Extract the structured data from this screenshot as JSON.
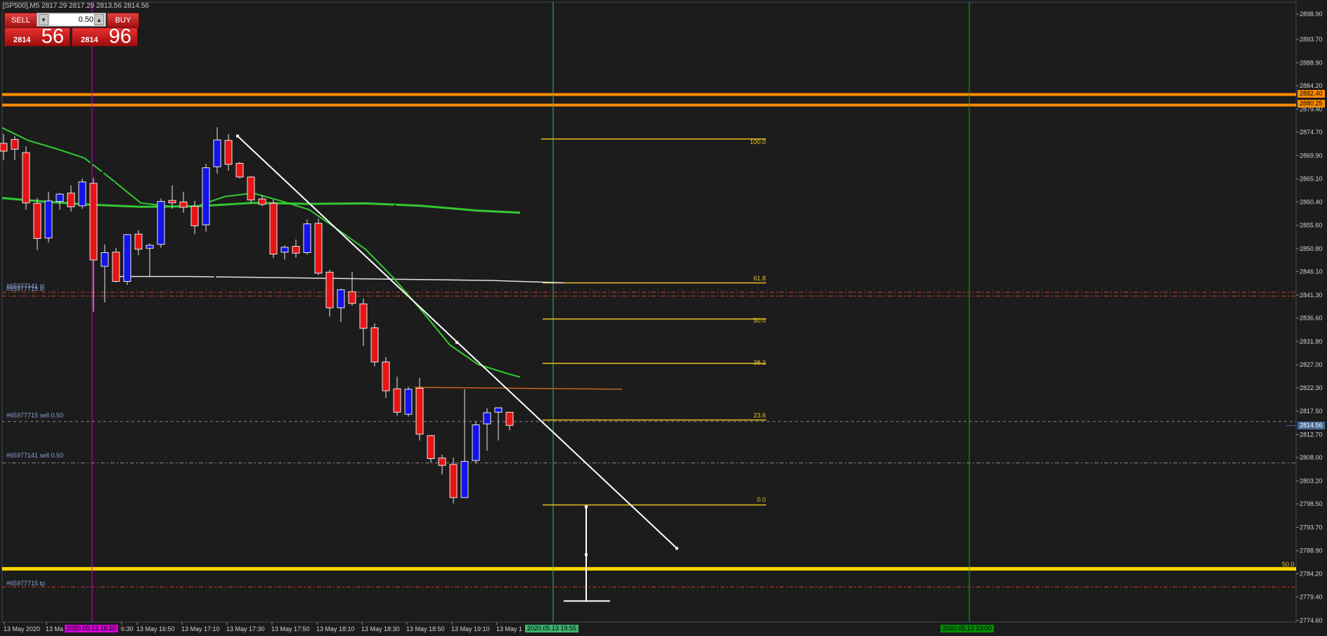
{
  "header": {
    "title": "[SP500],M5  2817.29 2817.29 2813.56 2814.56"
  },
  "trade_panel": {
    "sell_label": "SELL",
    "buy_label": "BUY",
    "lot_value": "0.50",
    "sell_price_small": "2814",
    "sell_price_big": "56",
    "buy_price_small": "2814",
    "buy_price_big": "96",
    "down_icon": "triangle-down-icon",
    "up_icon": "triangle-up-icon"
  },
  "price_axis": {
    "labels": [
      "2898.90",
      "2893.70",
      "2888.90",
      "2884.20",
      "2879.40",
      "2874.70",
      "2869.90",
      "2865.10",
      "2860.40",
      "2855.60",
      "2850.80",
      "2846.10",
      "2841.30",
      "2836.60",
      "2831.80",
      "2827.00",
      "2822.30",
      "2817.50",
      "2812.70",
      "2808.00",
      "2803.20",
      "2798.50",
      "2793.70",
      "2788.90",
      "2784.20",
      "2779.40",
      "2774.60"
    ]
  },
  "time_axis": {
    "labels": [
      "13 May 2020",
      "13 Ma",
      "6:30",
      "13 May 16:50",
      "13 May 17:10",
      "13 May 17:30",
      "13 May 17:50",
      "13 May 18:10",
      "13 May 18:30",
      "13 May 18:50",
      "13 May 19:10",
      "13 May 1"
    ],
    "tag_magenta": "2020.05.13 16:10",
    "tag_cursor": "2020.05.13 19:55",
    "tag_right": "2020.05.13 23:00"
  },
  "price_tags": {
    "resistance_upper": "2882.40",
    "resistance_lower": "2880.25",
    "current": "2814.56"
  },
  "order_labels": {
    "sl_a": "#65977141 sl",
    "sl_b": "#65977715 sl",
    "sell_1": "#65977715 sell 0.50",
    "sell_2": "#65977141 sell 0.50",
    "tp": "#65977715 tp"
  },
  "fibonacci": {
    "levels": [
      "100.0",
      "61.8",
      "50.0",
      "38.2",
      "23.6",
      "0.0"
    ]
  },
  "yellow_line_label": "50.0",
  "colors": {
    "background": "#1c1c1c",
    "bull_candle": "#1414e8",
    "bear_candle": "#e81414",
    "ma_line": "#32c832",
    "resistance": "#ff8c00",
    "support": "#ffd700",
    "fib": "#e8c020",
    "vertical_magenta": "#d200d2",
    "vertical_green": "#00b400"
  },
  "chart_data": {
    "type": "candlestick",
    "symbol": "[SP500]",
    "timeframe": "M5",
    "ylim": [
      2774.6,
      2898.9
    ],
    "candles": [
      {
        "o": 2872.4,
        "h": 2874.3,
        "l": 2869.0,
        "c": 2870.8
      },
      {
        "o": 2873.2,
        "h": 2873.9,
        "l": 2869.0,
        "c": 2871.2
      },
      {
        "o": 2870.5,
        "h": 2871.8,
        "l": 2858.8,
        "c": 2860.2
      },
      {
        "o": 2860.1,
        "h": 2861.2,
        "l": 2850.5,
        "c": 2852.9
      },
      {
        "o": 2853.0,
        "h": 2862.5,
        "l": 2852.1,
        "c": 2860.6
      },
      {
        "o": 2860.5,
        "h": 2862.2,
        "l": 2858.8,
        "c": 2862.0
      },
      {
        "o": 2862.2,
        "h": 2863.8,
        "l": 2858.4,
        "c": 2859.4
      },
      {
        "o": 2859.6,
        "h": 2865.2,
        "l": 2859.0,
        "c": 2864.5
      },
      {
        "o": 2864.2,
        "h": 2865.3,
        "l": 2837.9,
        "c": 2848.5
      },
      {
        "o": 2847.2,
        "h": 2851.7,
        "l": 2839.8,
        "c": 2850.0
      },
      {
        "o": 2850.1,
        "h": 2851.0,
        "l": 2843.9,
        "c": 2844.1
      },
      {
        "o": 2844.1,
        "h": 2853.7,
        "l": 2843.4,
        "c": 2853.7
      },
      {
        "o": 2853.8,
        "h": 2854.6,
        "l": 2849.5,
        "c": 2850.7
      },
      {
        "o": 2850.9,
        "h": 2851.9,
        "l": 2845.0,
        "c": 2851.5
      },
      {
        "o": 2851.7,
        "h": 2861.1,
        "l": 2851.0,
        "c": 2860.5
      },
      {
        "o": 2860.7,
        "h": 2863.8,
        "l": 2859.0,
        "c": 2860.2
      },
      {
        "o": 2860.4,
        "h": 2862.5,
        "l": 2858.2,
        "c": 2859.3
      },
      {
        "o": 2859.5,
        "h": 2860.6,
        "l": 2853.8,
        "c": 2855.5
      },
      {
        "o": 2855.7,
        "h": 2868.2,
        "l": 2854.3,
        "c": 2867.4
      },
      {
        "o": 2867.6,
        "h": 2875.7,
        "l": 2866.2,
        "c": 2873.1
      },
      {
        "o": 2873.0,
        "h": 2874.3,
        "l": 2866.8,
        "c": 2868.1
      },
      {
        "o": 2868.3,
        "h": 2868.6,
        "l": 2865.2,
        "c": 2865.5
      },
      {
        "o": 2865.5,
        "h": 2865.7,
        "l": 2860.2,
        "c": 2860.8
      },
      {
        "o": 2861.0,
        "h": 2861.8,
        "l": 2859.5,
        "c": 2859.9
      },
      {
        "o": 2860.1,
        "h": 2860.9,
        "l": 2848.9,
        "c": 2849.7
      },
      {
        "o": 2850.1,
        "h": 2851.5,
        "l": 2848.6,
        "c": 2851.1
      },
      {
        "o": 2851.3,
        "h": 2852.7,
        "l": 2849.0,
        "c": 2849.9
      },
      {
        "o": 2850.0,
        "h": 2856.8,
        "l": 2849.6,
        "c": 2855.9
      },
      {
        "o": 2856.0,
        "h": 2857.0,
        "l": 2845.4,
        "c": 2845.8
      },
      {
        "o": 2846.0,
        "h": 2846.5,
        "l": 2836.9,
        "c": 2838.7
      },
      {
        "o": 2838.7,
        "h": 2842.6,
        "l": 2835.8,
        "c": 2842.4
      },
      {
        "o": 2842.0,
        "h": 2846.1,
        "l": 2839.1,
        "c": 2839.6
      },
      {
        "o": 2839.5,
        "h": 2840.6,
        "l": 2830.9,
        "c": 2834.5
      },
      {
        "o": 2834.6,
        "h": 2835.5,
        "l": 2826.7,
        "c": 2827.6
      },
      {
        "o": 2827.6,
        "h": 2828.6,
        "l": 2820.2,
        "c": 2821.7
      },
      {
        "o": 2822.1,
        "h": 2824.6,
        "l": 2816.6,
        "c": 2817.3
      },
      {
        "o": 2816.9,
        "h": 2822.5,
        "l": 2816.4,
        "c": 2822.0
      },
      {
        "o": 2822.2,
        "h": 2824.3,
        "l": 2811.5,
        "c": 2812.8
      },
      {
        "o": 2812.5,
        "h": 2812.6,
        "l": 2806.9,
        "c": 2807.8
      },
      {
        "o": 2807.9,
        "h": 2808.6,
        "l": 2804.5,
        "c": 2806.4
      },
      {
        "o": 2806.6,
        "h": 2808.0,
        "l": 2798.6,
        "c": 2799.8
      },
      {
        "o": 2799.8,
        "h": 2822.0,
        "l": 2799.7,
        "c": 2807.2
      },
      {
        "o": 2807.4,
        "h": 2815.3,
        "l": 2806.8,
        "c": 2814.7
      },
      {
        "o": 2814.9,
        "h": 2818.1,
        "l": 2809.4,
        "c": 2817.2
      },
      {
        "o": 2817.3,
        "h": 2818.2,
        "l": 2811.5,
        "c": 2818.2
      },
      {
        "o": 2817.3,
        "h": 2817.3,
        "l": 2813.6,
        "c": 2814.6
      }
    ]
  }
}
